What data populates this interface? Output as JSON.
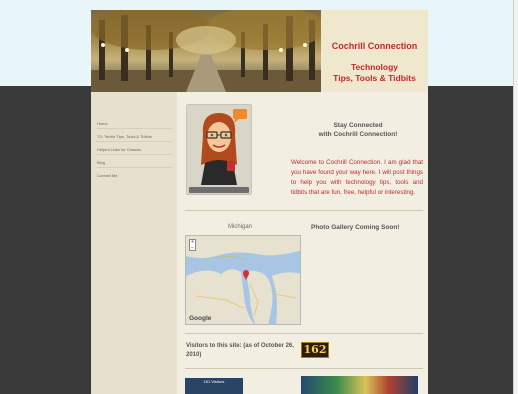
{
  "site": {
    "title": "Cochrill Connection",
    "tagline_line1": "Technology",
    "tagline_line2": "Tips, Tools & Tidbits"
  },
  "nav": {
    "items": [
      {
        "label": "Home"
      },
      {
        "label": "T3: Techie Tips, Tools & Tidbits"
      },
      {
        "label": "Helpful Links for Classes"
      },
      {
        "label": "Blog"
      },
      {
        "label": "Contact Me"
      }
    ]
  },
  "main": {
    "stay_line1": "Stay Connected",
    "stay_line2": "with Cochrill Connection!",
    "welcome": "Welcome to Cochrill Connection. I am glad that you have found your way here. I will post things to help you with technology tips, tools and tidbits that are fun, free, helpful or interesting.",
    "map_heading": "Michigan",
    "map_logo": "Google",
    "gallery_heading": "Photo Gallery Coming Soon!",
    "visitors_text": "Visitors to this site: (as of October 26, 2010)",
    "visitor_count": "162",
    "thumb_left_label": "161 Visitors"
  },
  "colors": {
    "accent_red": "#c8282b",
    "page_bg": "#f2efe2",
    "sidebar_bg": "#e6e1cc"
  }
}
